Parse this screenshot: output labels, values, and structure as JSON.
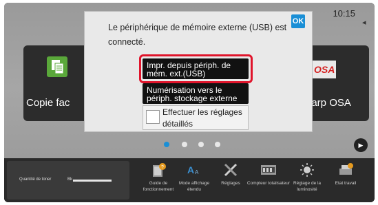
{
  "status": {
    "time": "10:15"
  },
  "tiles": {
    "left": {
      "label": "Copie fac",
      "icon": "copy-icon"
    },
    "right": {
      "label": "narp OSA",
      "icon": "sharp-osa-icon",
      "logo_text": "OSA"
    }
  },
  "pager": {
    "pages": 4,
    "active": 1
  },
  "dialog": {
    "message": "Le périphérique de mémoire externe (USB) est connecté.",
    "ok_label": "OK",
    "options": [
      {
        "label": "Impr. depuis périph. de mém. ext.(USB)",
        "highlighted": true
      },
      {
        "label": "Numérisation vers le périph. stockage externe"
      }
    ],
    "checkbox": {
      "label": "Effectuer les réglages détaillés",
      "checked": false
    }
  },
  "toner": {
    "label": "Quantité de toner",
    "channel": "Bk",
    "level": 1.0
  },
  "shortcuts": [
    {
      "label": "Guide de fonctionnement",
      "icon": "guide-icon"
    },
    {
      "label": "Mode affichage étendu",
      "icon": "text-size-icon"
    },
    {
      "label": "Réglages",
      "icon": "settings-tools-icon"
    },
    {
      "label": "Compteur totalisateur",
      "icon": "counter-icon"
    },
    {
      "label": "Réglage de la luminosité",
      "icon": "brightness-icon"
    },
    {
      "label": "Etat travail",
      "icon": "job-status-icon"
    }
  ],
  "colors": {
    "accent": "#1a8fd6",
    "highlight": "#e0142b",
    "tile": "#2c2c2c"
  }
}
